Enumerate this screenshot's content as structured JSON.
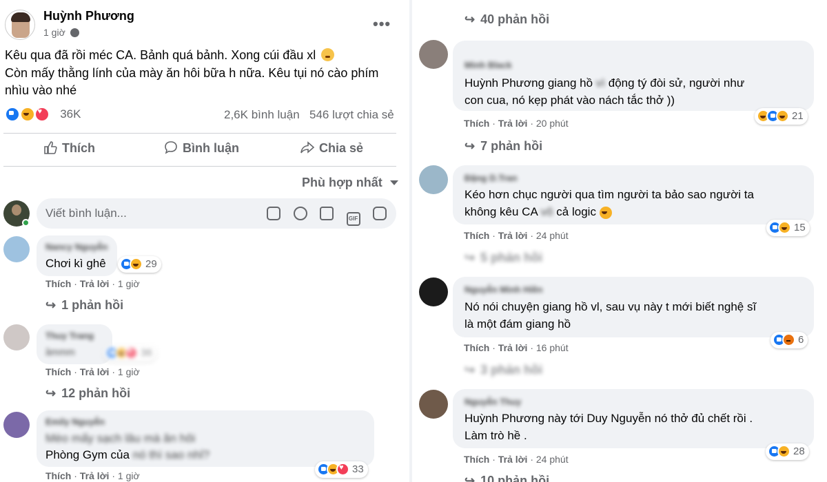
{
  "post": {
    "author": "Huỳnh Phương",
    "time": "1 giờ",
    "line1": "Kêu qua đã rồi méc CA. Bảnh quá bảnh. Xong cúi đầu xl",
    "line2": "Còn mấy thằng lính của mày ăn hôi bữa h nữa. Kêu tụi nó cào phím",
    "line3": "nhìu vào nhé",
    "reaction_count": "36K",
    "comment_count": "2,6K bình luận",
    "share_count": "546 lượt chia sẻ",
    "like_label": "Thích",
    "comment_label": "Bình luận",
    "share_label": "Chia sẻ",
    "sort_label": "Phù hợp nhất",
    "input_placeholder": "Viết bình luận..."
  },
  "meta_labels": {
    "like": "Thích",
    "reply": "Trả lời"
  },
  "left_comments": [
    {
      "name": "Nancy Nguyễn",
      "text": "Chơi kì ghê",
      "reactions": "29",
      "time": "1 giờ",
      "replies": "1 phản hồi"
    },
    {
      "name": "Thuy Trang",
      "text": "ầmmm",
      "reactions": "36",
      "time": "1 giờ",
      "replies": "12 phản hồi"
    },
    {
      "name": "Emily Nguyễn",
      "text1": "Mèo mấy sạch lâu mà ăn hôi",
      "text2": "Phòng Gym của",
      "text2_hidden": "nó thì sao nhỉ?",
      "reactions": "33",
      "time": "1 giờ"
    }
  ],
  "right_top": {
    "replies": "40 phản hồi"
  },
  "right_comments": [
    {
      "name": "Minh Black",
      "text1": "Huỳnh Phương giang hồ",
      "text1_hidden": "vì",
      "text1b": "động tý đòi sử, người như",
      "text2": "con cua, nó kẹp phát vào nách tắc thở ))",
      "reactions": "21",
      "time": "20 phút",
      "replies": "7 phản hồi"
    },
    {
      "name": "Đặng D.Tran",
      "text1": "Kéo hơn chục người qua tìm người ta bảo sao người ta",
      "text2": "không kêu CA",
      "text2_hidden": "vô",
      "text2b": "cả logic",
      "reactions": "15",
      "time": "24 phút",
      "replies": "5 phản hồi"
    },
    {
      "name": "Nguyễn Minh Hiền",
      "text1": "Nó nói chuyện giang hồ vl, sau vụ này t mới biết nghệ sĩ",
      "text2": "là một đám giang hồ",
      "reactions": "6",
      "time": "16 phút",
      "replies": "3 phản hồi"
    },
    {
      "name": "Nguyễn Thuy",
      "text1": "Huỳnh Phương này tới Duy Nguyễn nó thở đủ chết rồi .",
      "text2": "Làm trò hề .",
      "reactions": "28",
      "time": "24 phút",
      "replies": "10 phản hồi"
    }
  ],
  "colors": {
    "brand": "#1877f2",
    "bubble": "#f0f2f5",
    "muted": "#65676b"
  }
}
